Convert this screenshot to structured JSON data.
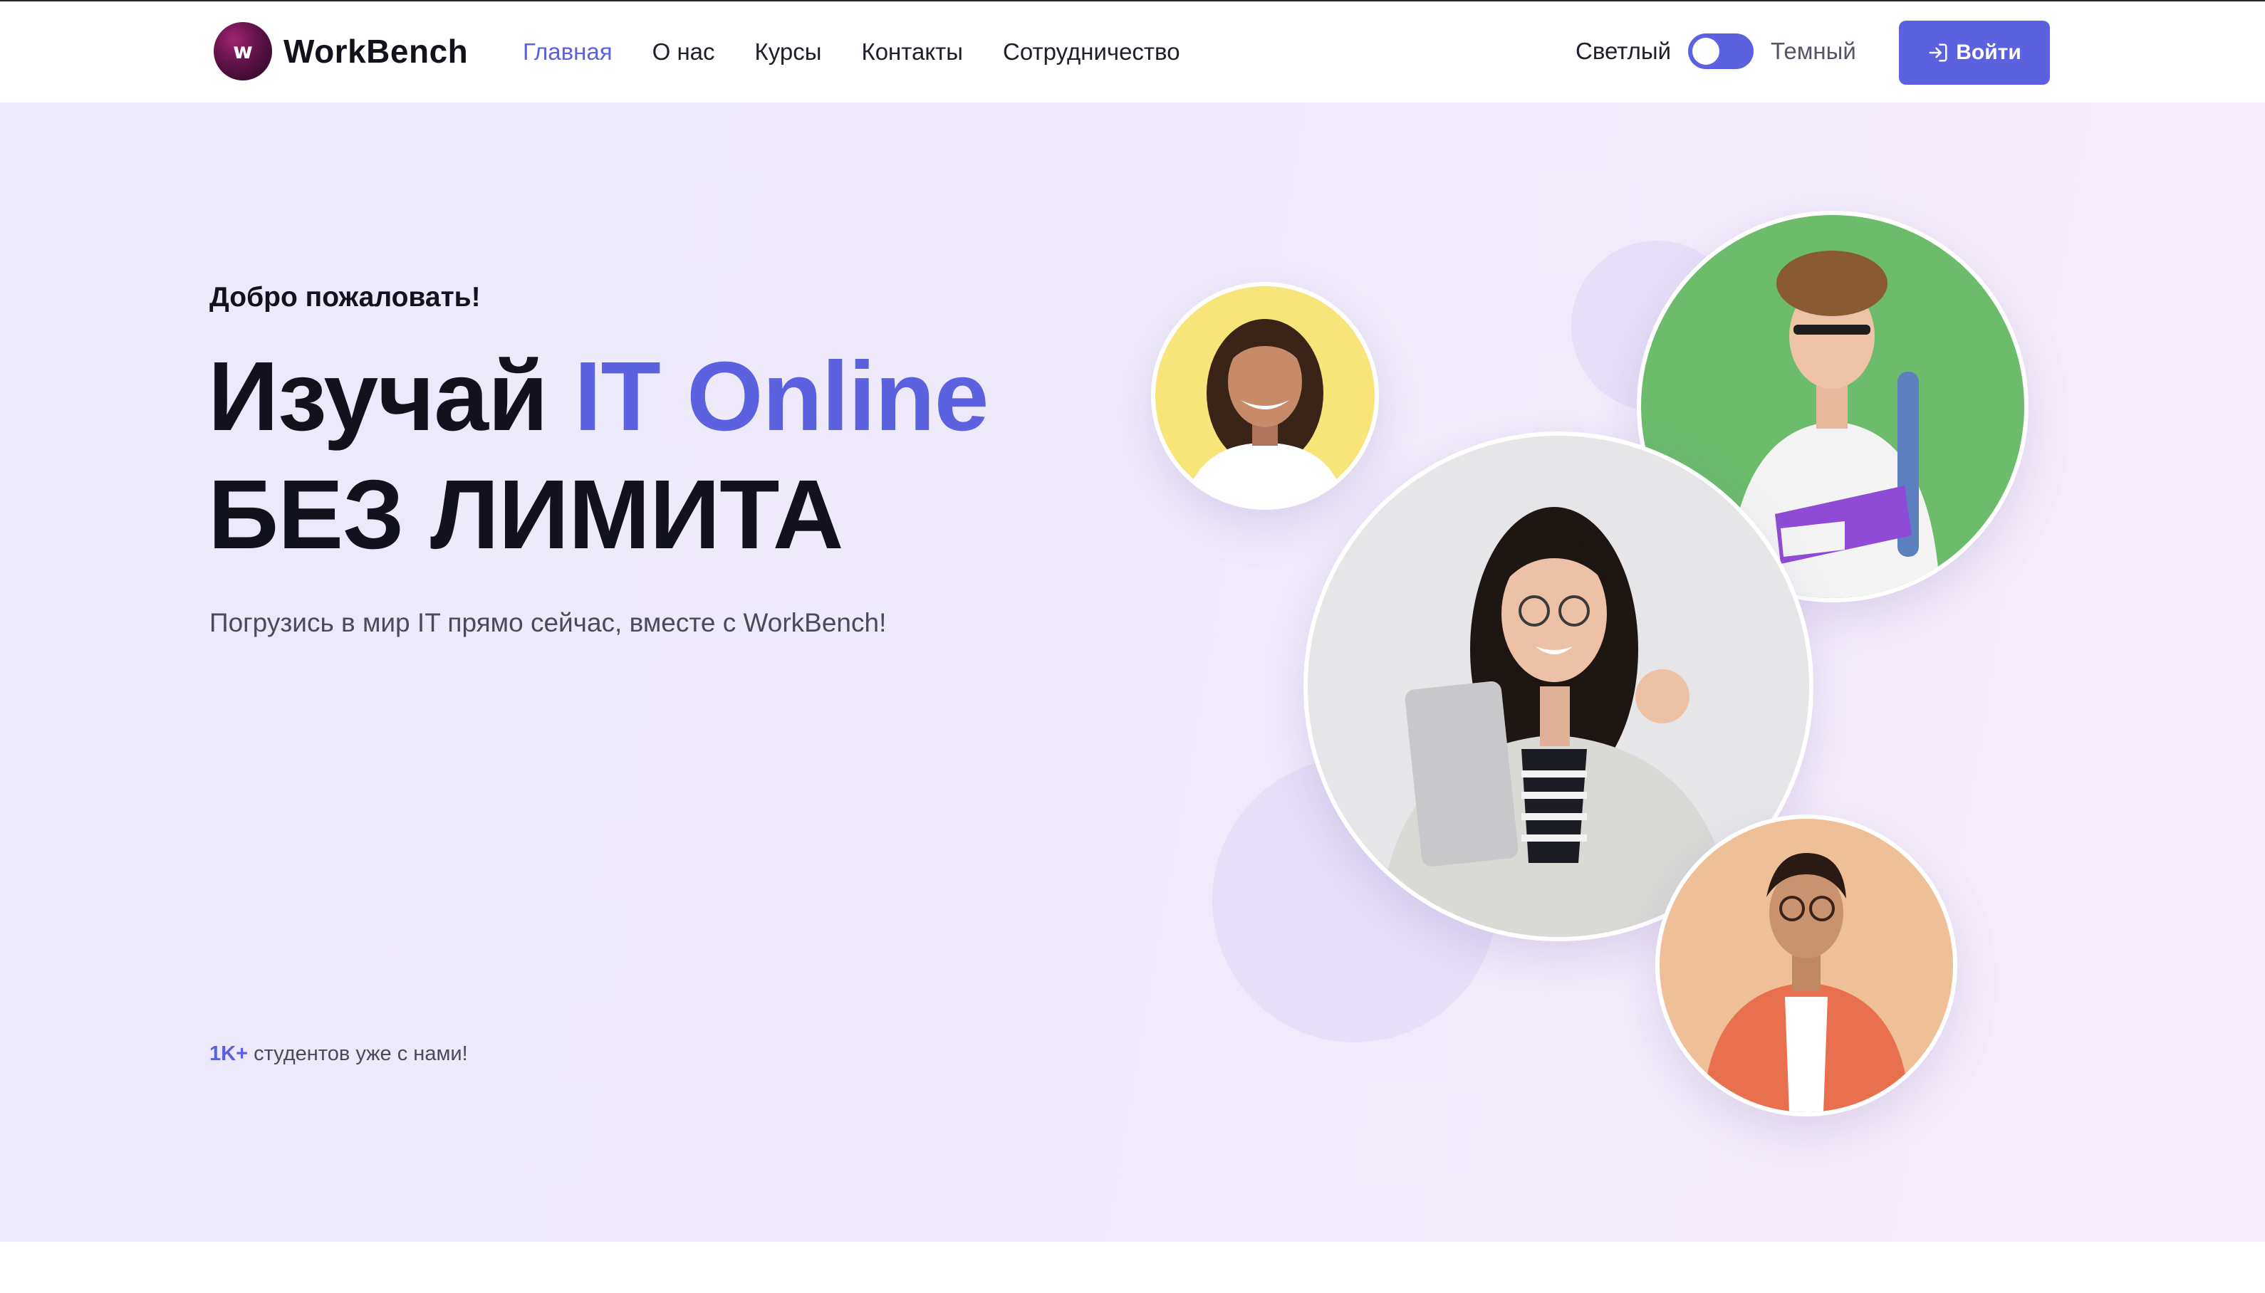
{
  "header": {
    "logo_letter": "w",
    "logo_text": "WorkBench",
    "nav": [
      {
        "label": "Главная",
        "active": true
      },
      {
        "label": "О нас",
        "active": false
      },
      {
        "label": "Курсы",
        "active": false
      },
      {
        "label": "Контакты",
        "active": false
      },
      {
        "label": "Сотрудничество",
        "active": false
      }
    ],
    "theme_light_label": "Светлый",
    "theme_dark_label": "Темный",
    "login_label": "Войти"
  },
  "hero": {
    "welcome": "Добро пожаловать!",
    "headline_line1_prefix": "Изучай ",
    "headline_line1_accent": "IT Online",
    "headline_line2": "БЕЗ ЛИМИТА",
    "subtitle": "Погрузись в мир IT прямо сейчас, вместе с WorkBench!",
    "students_count": "1K+",
    "students_text": " студентов уже с нами!"
  },
  "colors": {
    "accent": "#5b61df",
    "text": "#12121c",
    "photo_yellow": "#f7e57a",
    "photo_green": "#6cbc6c",
    "photo_grey": "#e6e6e8",
    "photo_peach": "#efbf98"
  },
  "icons": {
    "login": "login-icon",
    "logo": "logo-mark"
  }
}
